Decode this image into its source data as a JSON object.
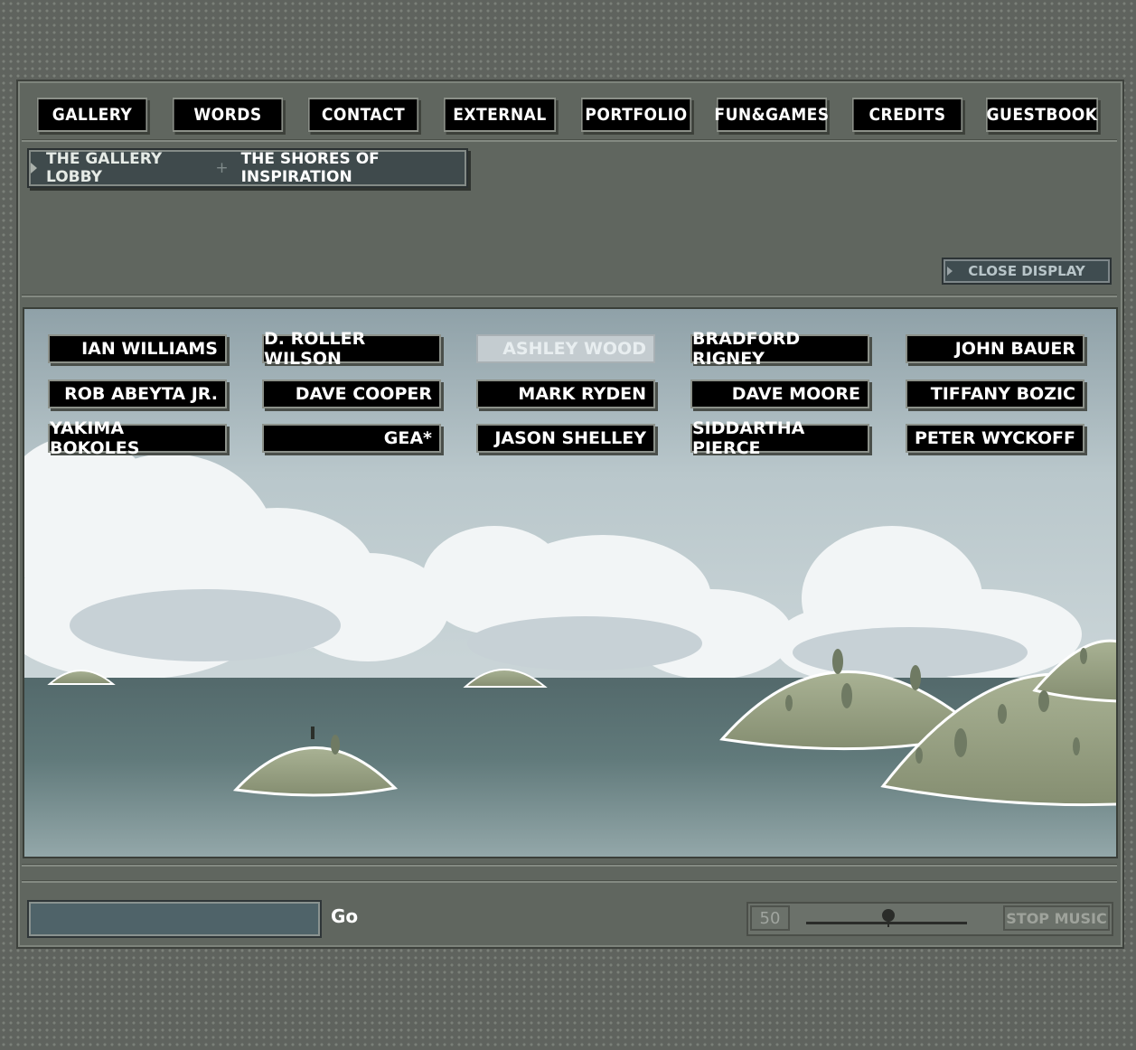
{
  "nav": {
    "items": [
      {
        "label": "GALLERY"
      },
      {
        "label": "WORDS"
      },
      {
        "label": "CONTACT"
      },
      {
        "label": "EXTERNAL"
      },
      {
        "label": "PORTFOLIO"
      },
      {
        "label": "FUN&GAMES"
      },
      {
        "label": "CREDITS"
      },
      {
        "label": "GUESTBOOK"
      }
    ]
  },
  "breadcrumb": {
    "first": "THE GALLERY LOBBY",
    "separator": "+",
    "second": "THE SHORES OF INSPIRATION"
  },
  "display": {
    "close_label": "CLOSE DISPLAY"
  },
  "artists": [
    {
      "name": "IAN WILLIAMS"
    },
    {
      "name": "D. ROLLER WILSON"
    },
    {
      "name": "ASHLEY WOOD",
      "state": "selected"
    },
    {
      "name": "BRADFORD RIGNEY"
    },
    {
      "name": "JOHN BAUER"
    },
    {
      "name": "ROB ABEYTA JR."
    },
    {
      "name": "DAVE COOPER"
    },
    {
      "name": "MARK RYDEN"
    },
    {
      "name": "DAVE MOORE"
    },
    {
      "name": "TIFFANY BOZIC"
    },
    {
      "name": "YAKIMA BOKOLES"
    },
    {
      "name": "GEA*"
    },
    {
      "name": "JASON SHELLEY"
    },
    {
      "name": "SIDDARTHA PIERCE"
    },
    {
      "name": "PETER WYCKOFF"
    }
  ],
  "search": {
    "value": "",
    "go_label": "Go"
  },
  "music": {
    "volume": "50",
    "stop_label": "STOP MUSIC"
  },
  "colors": {
    "button_bg": "#000000",
    "frame_bg": "#60665f",
    "sea": "#5f7779",
    "island": "#9aa383"
  }
}
